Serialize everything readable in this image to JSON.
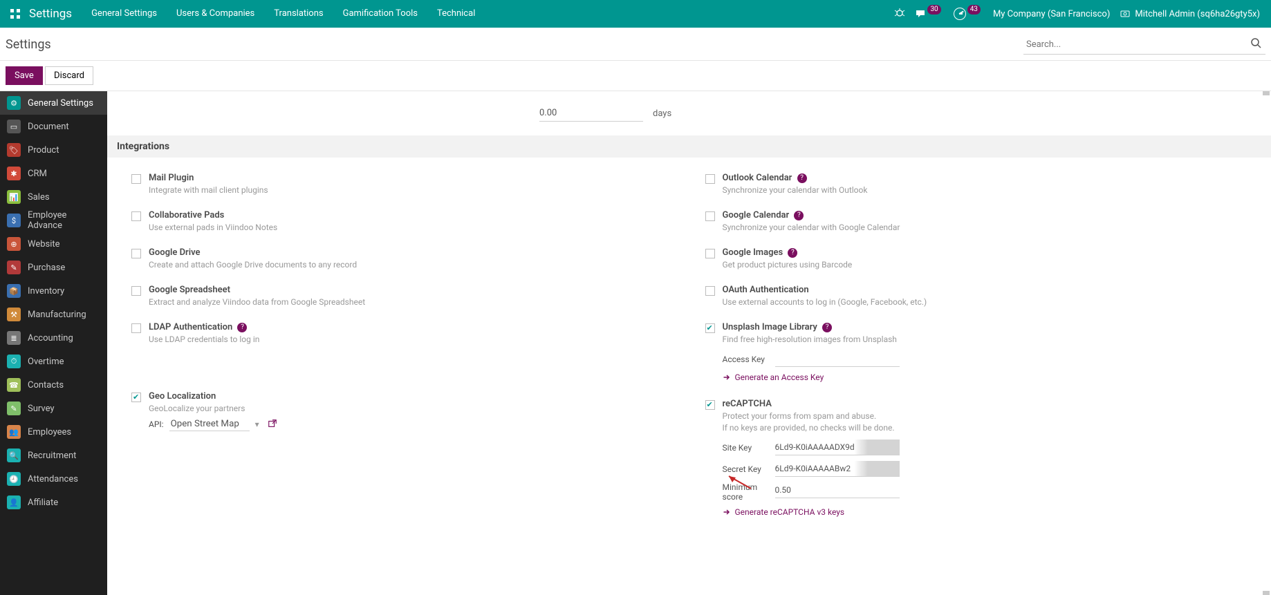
{
  "nav": {
    "brand": "Settings",
    "menu": [
      "General Settings",
      "Users & Companies",
      "Translations",
      "Gamification Tools",
      "Technical"
    ],
    "msg_count": "30",
    "act_count": "43",
    "company": "My Company (San Francisco)",
    "user": "Mitchell Admin (sq6ha26gty5x)"
  },
  "page": {
    "title": "Settings",
    "search_ph": "Search...",
    "save": "Save",
    "discard": "Discard"
  },
  "sidebar": {
    "items": [
      {
        "label": "General Settings",
        "color": "#009690",
        "glyph": "⚙"
      },
      {
        "label": "Document",
        "color": "#555",
        "glyph": "▭"
      },
      {
        "label": "Product",
        "color": "#b33a2e",
        "glyph": "🏷"
      },
      {
        "label": "CRM",
        "color": "#d14a3a",
        "glyph": "✱"
      },
      {
        "label": "Sales",
        "color": "#8bbf3d",
        "glyph": "📊"
      },
      {
        "label": "Employee Advance",
        "color": "#3a6fb0",
        "glyph": "$"
      },
      {
        "label": "Website",
        "color": "#c9553a",
        "glyph": "⊕"
      },
      {
        "label": "Purchase",
        "color": "#b23a3a",
        "glyph": "✎"
      },
      {
        "label": "Inventory",
        "color": "#3a6fb0",
        "glyph": "📦"
      },
      {
        "label": "Manufacturing",
        "color": "#d08a3a",
        "glyph": "⚒"
      },
      {
        "label": "Accounting",
        "color": "#777",
        "glyph": "≣"
      },
      {
        "label": "Overtime",
        "color": "#1bb1b1",
        "glyph": "⏱"
      },
      {
        "label": "Contacts",
        "color": "#9fbf5a",
        "glyph": "☎"
      },
      {
        "label": "Survey",
        "color": "#7fbf6a",
        "glyph": "✎"
      },
      {
        "label": "Employees",
        "color": "#d8844a",
        "glyph": "👥"
      },
      {
        "label": "Recruitment",
        "color": "#1bb1b1",
        "glyph": "🔍"
      },
      {
        "label": "Attendances",
        "color": "#1bb1b1",
        "glyph": "🕘"
      },
      {
        "label": "Affiliate",
        "color": "#1bb1b1",
        "glyph": "👤"
      }
    ]
  },
  "days": {
    "value": "0.00",
    "unit": "days"
  },
  "section": "Integrations",
  "left_settings": [
    {
      "title": "Mail Plugin",
      "desc": "Integrate with mail client plugins",
      "help": false,
      "checked": false
    },
    {
      "title": "Collaborative Pads",
      "desc": "Use external pads in Viindoo Notes",
      "help": false,
      "checked": false
    },
    {
      "title": "Google Drive",
      "desc": "Create and attach Google Drive documents to any record",
      "help": false,
      "checked": false
    },
    {
      "title": "Google Spreadsheet",
      "desc": "Extract and analyze Viindoo data from Google Spreadsheet",
      "help": false,
      "checked": false
    },
    {
      "title": "LDAP Authentication",
      "desc": "Use LDAP credentials to log in",
      "help": true,
      "checked": false
    },
    {
      "title": "Geo Localization",
      "desc": "GeoLocalize your partners",
      "help": false,
      "checked": true
    }
  ],
  "right_settings": [
    {
      "title": "Outlook Calendar",
      "desc": "Synchronize your calendar with Outlook",
      "help": true,
      "checked": false
    },
    {
      "title": "Google Calendar",
      "desc": "Synchronize your calendar with Google Calendar",
      "help": true,
      "checked": false
    },
    {
      "title": "Google Images",
      "desc": "Get product pictures using Barcode",
      "help": true,
      "checked": false
    },
    {
      "title": "OAuth Authentication",
      "desc": "Use external accounts to log in (Google, Facebook, etc.)",
      "help": false,
      "checked": false
    },
    {
      "title": "Unsplash Image Library",
      "desc": "Find free high-resolution images from Unsplash",
      "help": true,
      "checked": true
    },
    {
      "title": "reCAPTCHA",
      "desc": "Protect your forms from spam and abuse.",
      "desc2": "If no keys are provided, no checks will be done.",
      "help": false,
      "checked": true
    }
  ],
  "unsplash": {
    "access_label": "Access Key",
    "link": "Generate an Access Key"
  },
  "geo": {
    "api_label": "API:",
    "api_value": "Open Street Map"
  },
  "recaptcha": {
    "site_key_label": "Site Key",
    "site_key": "6Ld9-K0iAAAAADX9d",
    "secret_key_label": "Secret Key",
    "secret_key": "6Ld9-K0iAAAAABw2",
    "min_label1": "Minimum",
    "min_label2": "score",
    "min_value": "0.50",
    "link": "Generate reCAPTCHA v3 keys"
  }
}
